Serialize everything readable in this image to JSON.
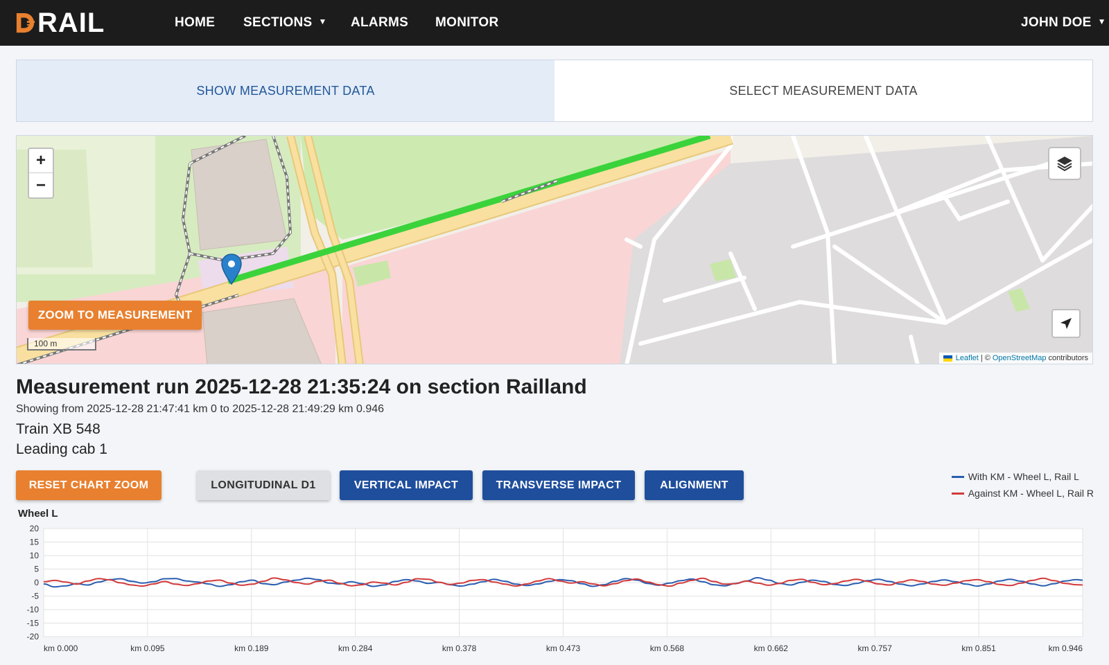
{
  "nav": {
    "logo": "RAIL",
    "items": [
      "HOME",
      "SECTIONS",
      "ALARMS",
      "MONITOR"
    ],
    "user": "JOHN DOE"
  },
  "tabs": {
    "show": "SHOW MEASUREMENT DATA",
    "select": "SELECT MEASUREMENT DATA"
  },
  "map": {
    "zoom_in": "+",
    "zoom_out": "−",
    "zoom_button": "ZOOM TO MEASUREMENT",
    "scale": "100 m",
    "attribution_leaflet": "Leaflet",
    "attribution_sep": "| ©",
    "attribution_osm": "OpenStreetMap",
    "attribution_tail": "contributors"
  },
  "run": {
    "title": "Measurement run 2025-12-28 21:35:24 on section Railland",
    "range": "Showing from 2025-12-28 21:47:41 km 0 to 2025-12-28 21:49:29 km 0.946",
    "train": "Train XB 548",
    "cab": "Leading cab 1"
  },
  "buttons": {
    "reset": "RESET CHART ZOOM",
    "longitudinal": "LONGITUDINAL D1",
    "vertical": "VERTICAL IMPACT",
    "transverse": "TRANSVERSE IMPACT",
    "alignment": "ALIGNMENT"
  },
  "legend": [
    {
      "label": "With KM - Wheel L, Rail L",
      "color": "#2a5db0"
    },
    {
      "label": "Against KM - Wheel L, Rail R",
      "color": "#d23a3a"
    }
  ],
  "chart_data": {
    "type": "line",
    "title": "Wheel L",
    "ylim": [
      -20,
      20
    ],
    "yticks": [
      20,
      15,
      10,
      5,
      0,
      -5,
      -10,
      -15,
      -20
    ],
    "xticks": [
      "km 0.000",
      "km 0.095",
      "km 0.189",
      "km 0.284",
      "km 0.378",
      "km 0.473",
      "km 0.568",
      "km 0.662",
      "km 0.757",
      "km 0.851",
      "km 0.946"
    ],
    "xlim": [
      0,
      0.946
    ],
    "grid": true,
    "series": [
      {
        "name": "With KM - Wheel L, Rail L",
        "color": "#2a5db0",
        "x": [
          0,
          0.01,
          0.02,
          0.03,
          0.04,
          0.05,
          0.06,
          0.07,
          0.08,
          0.09,
          0.1,
          0.11,
          0.12,
          0.13,
          0.14,
          0.15,
          0.16,
          0.17,
          0.18,
          0.19,
          0.2,
          0.21,
          0.22,
          0.23,
          0.24,
          0.25,
          0.26,
          0.27,
          0.28,
          0.29,
          0.3,
          0.31,
          0.32,
          0.33,
          0.34,
          0.35,
          0.36,
          0.37,
          0.38,
          0.39,
          0.4,
          0.41,
          0.42,
          0.43,
          0.44,
          0.45,
          0.46,
          0.47,
          0.48,
          0.49,
          0.5,
          0.51,
          0.52,
          0.53,
          0.54,
          0.55,
          0.56,
          0.57,
          0.58,
          0.59,
          0.6,
          0.61,
          0.62,
          0.63,
          0.64,
          0.65,
          0.66,
          0.67,
          0.68,
          0.69,
          0.7,
          0.71,
          0.72,
          0.73,
          0.74,
          0.75,
          0.76,
          0.77,
          0.78,
          0.79,
          0.8,
          0.81,
          0.82,
          0.83,
          0.84,
          0.85,
          0.86,
          0.87,
          0.88,
          0.89,
          0.9,
          0.91,
          0.92,
          0.93,
          0.94,
          0.946
        ],
        "values": [
          -0.5,
          -1.6,
          -1.2,
          -0.4,
          -0.9,
          0.2,
          1.1,
          1.4,
          0.5,
          -0.2,
          0.3,
          1.4,
          1.5,
          0.6,
          0.2,
          -0.5,
          -1.4,
          -0.8,
          0.3,
          0.9,
          -0.4,
          -0.8,
          0.2,
          0.9,
          1.6,
          1.1,
          -0.2,
          -0.5,
          0.3,
          -0.4,
          -1.4,
          -0.9,
          0.4,
          1.1,
          0.6,
          -0.3,
          0.1,
          -0.8,
          -1.3,
          -0.6,
          0.3,
          1.2,
          0.5,
          -0.6,
          -1.1,
          -0.5,
          0.4,
          1.1,
          0.7,
          -0.4,
          -1.4,
          -0.8,
          0.5,
          1.5,
          0.9,
          -0.3,
          -1.0,
          -0.2,
          0.7,
          1.3,
          0.3,
          -0.8,
          -1.2,
          -0.3,
          0.6,
          1.8,
          0.9,
          -0.3,
          -0.9,
          0.1,
          0.9,
          0.4,
          -0.7,
          -1.1,
          -0.3,
          0.7,
          1.2,
          0.4,
          -0.6,
          -1.2,
          -0.5,
          0.4,
          1.0,
          0.3,
          -0.6,
          -1.3,
          -0.5,
          0.6,
          1.2,
          0.5,
          -0.5,
          -1.2,
          -0.4,
          0.6,
          1.1,
          0.9
        ]
      },
      {
        "name": "Against KM - Wheel L, Rail R",
        "color": "#d23a3a",
        "x": [
          0,
          0.01,
          0.02,
          0.03,
          0.04,
          0.05,
          0.06,
          0.07,
          0.08,
          0.09,
          0.1,
          0.11,
          0.12,
          0.13,
          0.14,
          0.15,
          0.16,
          0.17,
          0.18,
          0.19,
          0.2,
          0.21,
          0.22,
          0.23,
          0.24,
          0.25,
          0.26,
          0.27,
          0.28,
          0.29,
          0.3,
          0.31,
          0.32,
          0.33,
          0.34,
          0.35,
          0.36,
          0.37,
          0.38,
          0.39,
          0.4,
          0.41,
          0.42,
          0.43,
          0.44,
          0.45,
          0.46,
          0.47,
          0.48,
          0.49,
          0.5,
          0.51,
          0.52,
          0.53,
          0.54,
          0.55,
          0.56,
          0.57,
          0.58,
          0.59,
          0.6,
          0.61,
          0.62,
          0.63,
          0.64,
          0.65,
          0.66,
          0.67,
          0.68,
          0.69,
          0.7,
          0.71,
          0.72,
          0.73,
          0.74,
          0.75,
          0.76,
          0.77,
          0.78,
          0.79,
          0.8,
          0.81,
          0.82,
          0.83,
          0.84,
          0.85,
          0.86,
          0.87,
          0.88,
          0.89,
          0.9,
          0.91,
          0.92,
          0.93,
          0.94,
          0.946
        ],
        "values": [
          0.3,
          0.8,
          0.2,
          -0.6,
          0.6,
          1.5,
          1.0,
          -0.1,
          -0.9,
          -1.3,
          -0.5,
          0.4,
          -0.6,
          -1.1,
          -0.4,
          0.6,
          0.9,
          -0.2,
          -1.0,
          -0.6,
          0.5,
          1.7,
          1.0,
          0.0,
          -0.6,
          0.5,
          0.9,
          -0.3,
          -1.2,
          -0.8,
          0.2,
          -0.2,
          -0.9,
          0.1,
          1.4,
          1.2,
          0.1,
          -0.7,
          -0.2,
          0.8,
          1.1,
          0.2,
          -0.6,
          -1.3,
          -0.5,
          0.6,
          1.5,
          0.6,
          -0.2,
          0.3,
          -0.5,
          -1.2,
          -0.4,
          0.7,
          1.3,
          0.2,
          -0.8,
          -1.3,
          -0.2,
          0.8,
          1.6,
          0.4,
          -0.6,
          -0.4,
          0.6,
          -0.2,
          -1.0,
          -0.3,
          0.8,
          1.2,
          0.1,
          -0.8,
          -0.4,
          0.6,
          1.2,
          0.5,
          -0.5,
          -0.9,
          0.2,
          1.0,
          0.4,
          -0.6,
          -1.0,
          -0.2,
          0.7,
          1.1,
          0.3,
          -0.7,
          -1.1,
          -0.2,
          0.8,
          1.6,
          0.7,
          -0.3,
          -0.8,
          -0.9
        ]
      }
    ]
  }
}
